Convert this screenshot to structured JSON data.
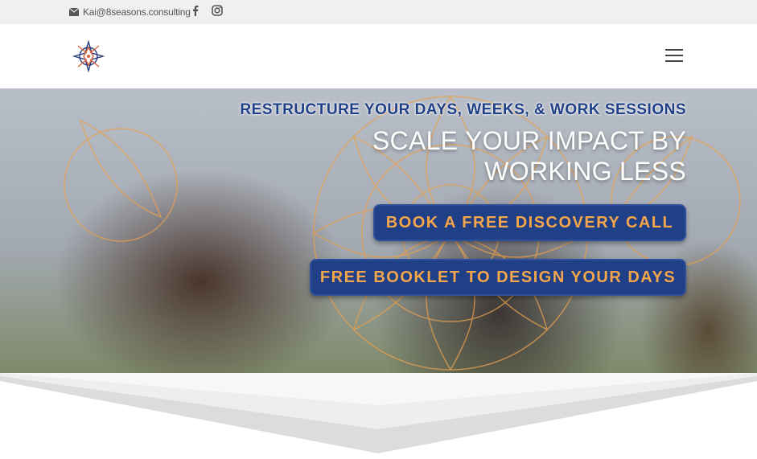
{
  "topbar": {
    "email": "Kai@8seasons.consulting",
    "social": [
      {
        "name": "facebook-icon"
      },
      {
        "name": "instagram-icon"
      }
    ]
  },
  "header": {
    "logo": "8 seasons logo",
    "menu_icon": "hamburger-menu-icon"
  },
  "hero": {
    "kicker": "RESTRUCTURE YOUR DAYS, WEEKS, & WORK SESSIONS",
    "headline": "SCALE YOUR IMPACT BY WORKING LESS",
    "buttons": {
      "call": "BOOK A FREE DISCOVERY CALL",
      "booklet": "FREE BOOKLET TO DESIGN YOUR DAYS"
    }
  },
  "colors": {
    "navy": "#1f3f86",
    "orange": "#f5a54a",
    "topbar_bg": "#f0f0f0"
  }
}
